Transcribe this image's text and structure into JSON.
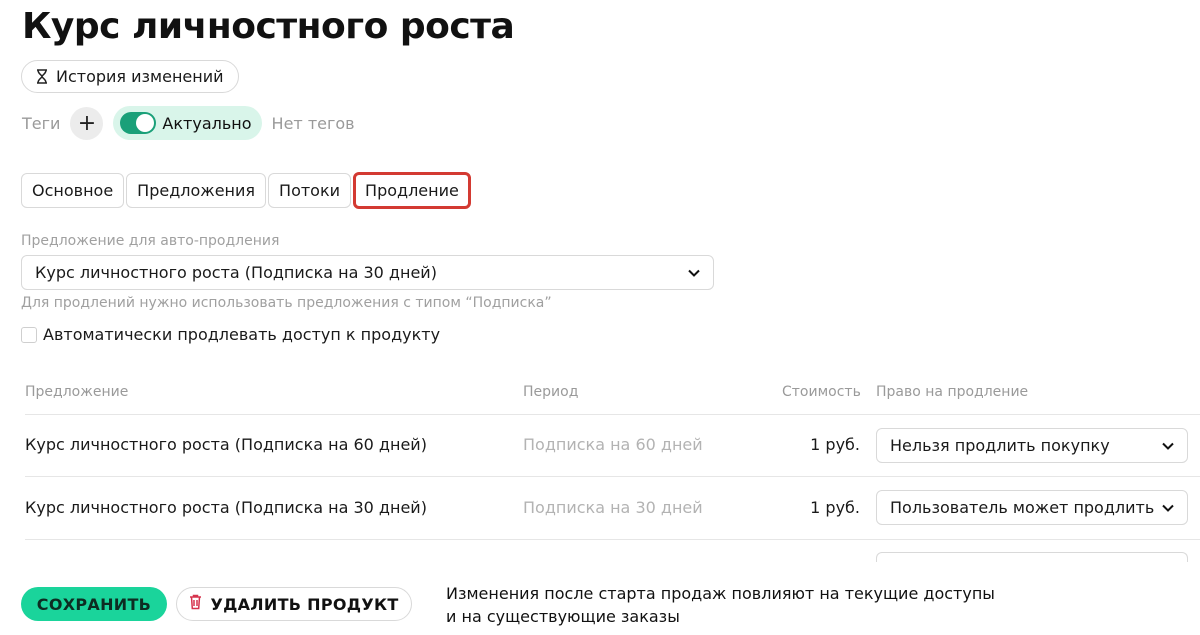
{
  "page": {
    "title": "Курс личностного роста",
    "history_button": "История изменений"
  },
  "tags": {
    "label": "Теги",
    "add_symbol": "+",
    "status_label": "Актуально",
    "status_on": true,
    "empty_text": "Нет тегов"
  },
  "tabs": [
    {
      "label": "Основное",
      "active": false
    },
    {
      "label": "Предложения",
      "active": false
    },
    {
      "label": "Потоки",
      "active": false
    },
    {
      "label": "Продление",
      "active": true
    }
  ],
  "renewal": {
    "field_label": "Предложение для авто-продления",
    "selected_offer": "Курс личностного роста (Подписка на 30 дней)",
    "hint": "Для продлений нужно использовать предложения с типом “Подписка”",
    "auto_renew_label": "Автоматически продлевать доступ к продукту",
    "auto_renew_checked": false
  },
  "table": {
    "headers": {
      "offer": "Предложение",
      "period": "Период",
      "price": "Стоимость",
      "right": "Право на продление"
    },
    "rows": [
      {
        "offer": "Курс личностного роста (Подписка на 60 дней)",
        "period": "Подписка на 60 дней",
        "price": "1 руб.",
        "right": "Нельзя продлить покупку"
      },
      {
        "offer": "Курс личностного роста (Подписка на 30 дней)",
        "period": "Подписка на 30 дней",
        "price": "1 руб.",
        "right": "Пользователь может продлить"
      }
    ]
  },
  "footer": {
    "save_label": "СОХРАНИТЬ",
    "delete_label": "УДАЛИТЬ ПРОДУКТ",
    "note_line1": "Изменения после старта продаж повлияют на текущие доступы",
    "note_line2": "и на существующие заказы"
  },
  "colors": {
    "accent": "#1ad49b",
    "toggle": "#1aa079",
    "chip_bg": "#d9f5ea",
    "highlight": "#d33a32",
    "trash": "#d6334d"
  },
  "icons": [
    "hourglass-icon",
    "plus-icon",
    "chevron-down-icon",
    "trash-icon"
  ]
}
